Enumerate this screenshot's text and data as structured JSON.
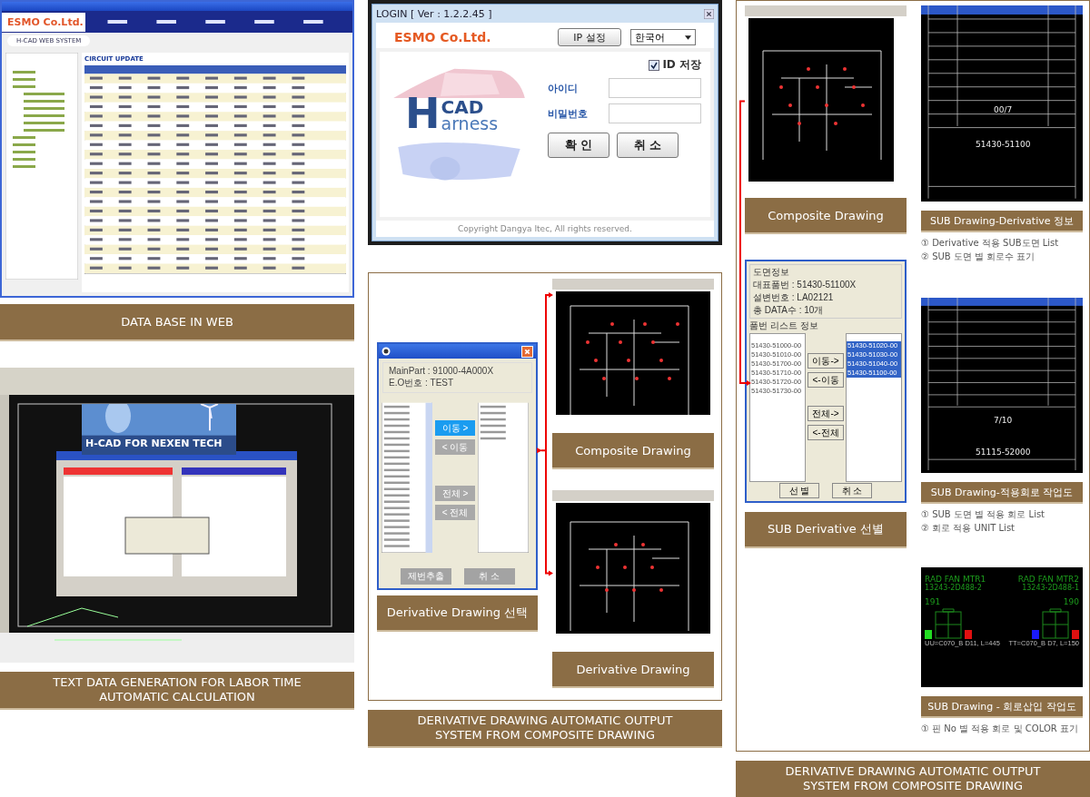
{
  "web_db": {
    "logo": "ESMO Co.Ltd.",
    "system_name": "H-CAD WEB SYSTEM",
    "section": "CIRCUIT UPDATE",
    "caption": "DATA BASE IN WEB"
  },
  "labor_time": {
    "banner": "H-CAD FOR NEXEN TECH",
    "caption": "TEXT DATA GENERATION FOR LABOR TIME  AUTOMATIC CALCULATION"
  },
  "login": {
    "title": "LOGIN [ Ver : 1.2.2.45 ]",
    "logo": "ESMO Co.Ltd.",
    "ip_button": "IP 설정",
    "language": "한국어",
    "brand": {
      "initial": "H",
      "word": "CAD",
      "rest": "arness"
    },
    "save_id": {
      "label": "ID 저장",
      "checked": true
    },
    "fields": [
      {
        "label": "아이디"
      },
      {
        "label": "비밀번호"
      }
    ],
    "buttons": [
      "확 인",
      "취 소"
    ],
    "copyright": "Copyright Dangya Itec, All rights reserved."
  },
  "composite_output": {
    "dialog": {
      "info": [
        "MainPart : 91000-4A000X",
        "E.O번호 : TEST"
      ],
      "move_buttons": [
        {
          "label": "이동 >",
          "active": true
        },
        {
          "label": "< 이동",
          "active": false
        },
        {
          "label": "전체 >",
          "active": false
        },
        {
          "label": "< 전체",
          "active": false
        }
      ],
      "buttons": [
        "제번추출",
        "취 소"
      ]
    },
    "dialog_caption": "Derivative Drawing 선택",
    "drawing_captions": [
      "Composite Drawing",
      "Derivative Drawing"
    ],
    "caption": "DERIVATIVE DRAWING AUTOMATIC OUTPUT SYSTEM FROM  COMPOSITE DRAWING"
  },
  "sub_output": {
    "drawing_caption": "Composite Drawing",
    "dialog": {
      "group_title": "도면정보",
      "info": [
        "대표품번 : 51430-51100X",
        "설변번호 : LA02121",
        "총 DATA수 : 10개"
      ],
      "list_title": "품번 리스트 정보",
      "left_items": [
        "51430-51000-00",
        "51430-51010-00",
        "51430-51700-00",
        "51430-51710-00",
        "51430-51720-00",
        "51430-51730-00"
      ],
      "right_items": [
        {
          "label": "51430-51020-00",
          "selected": true
        },
        {
          "label": "51430-51030-00",
          "selected": true
        },
        {
          "label": "51430-51040-00",
          "selected": true
        },
        {
          "label": "51430-51100-00",
          "selected": true
        }
      ],
      "move_buttons": [
        "이동->",
        "<-이동",
        "전체->",
        "<-전체"
      ],
      "buttons": [
        "선 별",
        "취 소"
      ]
    },
    "dialog_caption": "SUB Derivative 선별",
    "sheets": [
      {
        "kind": "title_block",
        "sheet": "00/7",
        "part": "51430-51100",
        "caption": "SUB Drawing-Derivative 정보",
        "notes": [
          "① Derivative 적용 SUB도면 List",
          "② SUB 도면 별  회로수 표기"
        ]
      },
      {
        "kind": "circuit_table",
        "sheet": "7/10",
        "part": "51115-52000",
        "caption": "SUB Drawing-적용회로 작업도",
        "notes": [
          "① SUB 도면 별 적용 회로 List",
          "② 회로 적용 UNIT List"
        ]
      },
      {
        "kind": "connector",
        "connectors": [
          {
            "name": "RAD FAN MTR1",
            "part": "13243-2D488-2",
            "number": "191",
            "wire": "UU=C070_B D11, L=445",
            "pins": [
              {
                "color": "#22dd22"
              },
              {
                "color": "#e01010"
              }
            ]
          },
          {
            "name": "RAD FAN MTR2",
            "part": "13243-2D488-1",
            "number": "190",
            "wire": "TT=C070_B D7, L=150",
            "pins": [
              {
                "color": "#1a1aff"
              },
              {
                "color": "#e01010"
              }
            ]
          }
        ],
        "caption": "SUB Drawing - 회로삽입 작업도",
        "notes": [
          "① 핀 No 별 적용 회로 및 COLOR 표기"
        ]
      }
    ],
    "caption": "DERIVATIVE DRAWING AUTOMATIC OUTPUT SYSTEM FROM COMPOSITE DRAWING"
  }
}
